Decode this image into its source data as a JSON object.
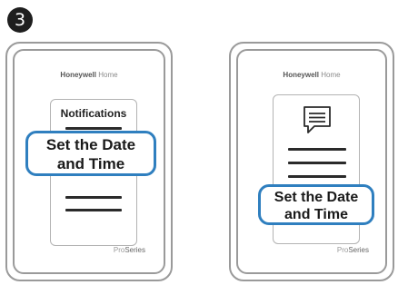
{
  "step": {
    "number": "3"
  },
  "left_device": {
    "brand_bold": "Honeywell",
    "brand_light": "Home",
    "panel_title": "Notifications",
    "highlight_line1": "Set the Date",
    "highlight_line2": "and Time",
    "footer_light": "Pro",
    "footer_bold": "Series"
  },
  "right_device": {
    "brand_bold": "Honeywell",
    "brand_light": "Home",
    "icon": "message-icon",
    "highlight_line1": "Set the Date",
    "highlight_line2": "and Time",
    "footer_light": "Pro",
    "footer_bold": "Series"
  },
  "colors": {
    "highlight": "#2f7fbf",
    "frame": "#9a9a9a"
  }
}
